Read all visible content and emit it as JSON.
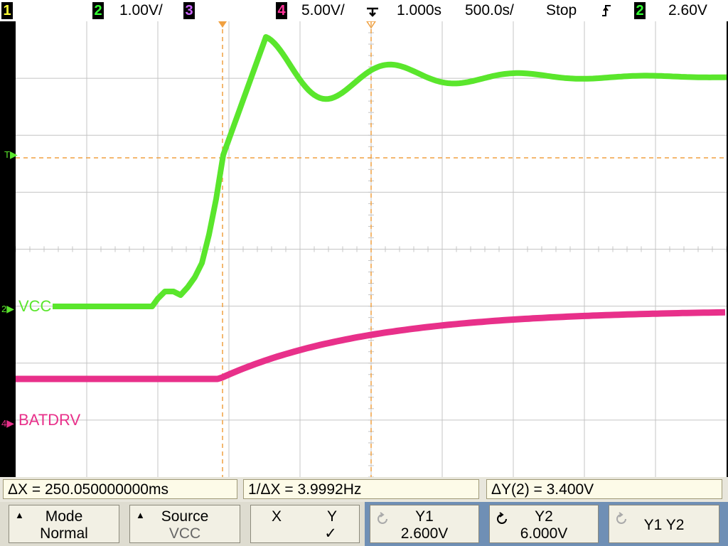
{
  "topbar": {
    "ch1_num": "1",
    "ch2_num": "2",
    "ch2_scale": "1.00V/",
    "ch3_num": "3",
    "ch4_num": "4",
    "ch4_scale": "5.00V/",
    "delay": "1.000s",
    "timebase": "500.0s/",
    "run_state": "Stop",
    "trigger_edge": "rising-edge-icon",
    "trigger_source": "2",
    "trigger_level": "2.60V"
  },
  "screen": {
    "trigger_level_marker": "T",
    "ch2_marker": "2",
    "ch2_label": "VCC",
    "ch4_marker": "4",
    "ch4_label": "BATDRV"
  },
  "measurements": {
    "delta_x": "ΔX = 250.050000000ms",
    "inv_delta_x": "1/ΔX = 3.9992Hz",
    "delta_y": "ΔY(2) = 3.400V"
  },
  "softkeys": {
    "mode_title": "Mode",
    "mode_value": "Normal",
    "source_title": "Source",
    "source_value": "VCC",
    "x_label": "X",
    "y_label": "Y",
    "y_check": "✓",
    "y1_title": "Y1",
    "y1_value": "2.600V",
    "y2_title": "Y2",
    "y2_value": "6.000V",
    "y1y2_label": "Y1 Y2"
  },
  "colors": {
    "ch2": "#5ae62c",
    "ch4": "#e8308a",
    "cursor": "#f0a040",
    "grid": "#bdbdbd"
  }
}
